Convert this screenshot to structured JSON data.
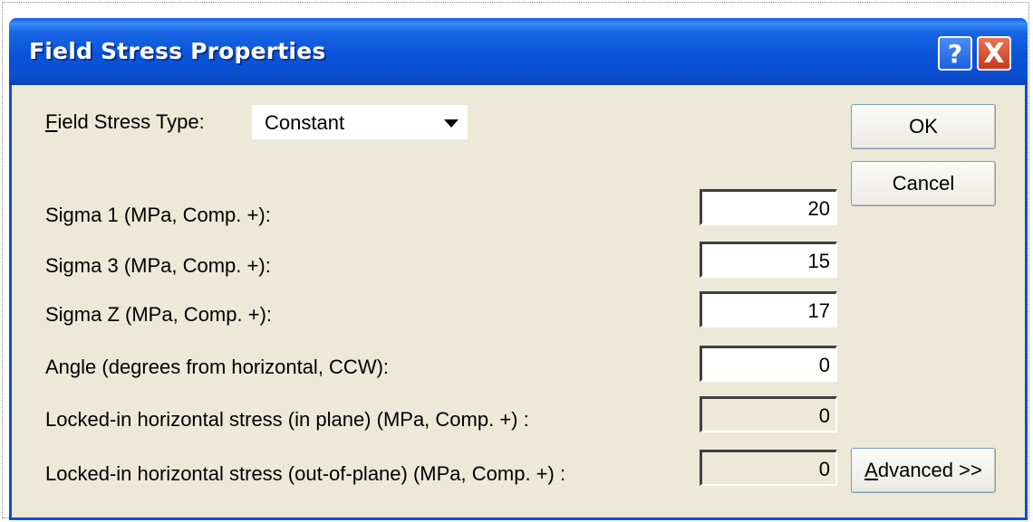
{
  "window": {
    "title": "Field Stress Properties"
  },
  "titlebar_buttons": {
    "help": "?",
    "close": "X"
  },
  "field_stress_type": {
    "label_accel": "F",
    "label_rest": "ield Stress Type:",
    "value": "Constant"
  },
  "fields": [
    {
      "label": "Sigma 1 (MPa, Comp. +):",
      "value": "20",
      "enabled": true
    },
    {
      "label": "Sigma 3 (MPa, Comp. +):",
      "value": "15",
      "enabled": true
    },
    {
      "label": "Sigma Z (MPa, Comp. +):",
      "value": "17",
      "enabled": true
    },
    {
      "label": "Angle (degrees from horizontal, CCW):",
      "value": "0",
      "enabled": true
    },
    {
      "label": "Locked-in horizontal stress (in plane) (MPa, Comp. +) :",
      "value": "0",
      "enabled": false
    },
    {
      "label": "Locked-in horizontal stress (out-of-plane) (MPa, Comp. +) :",
      "value": "0",
      "enabled": false
    }
  ],
  "buttons": {
    "ok": "OK",
    "cancel": "Cancel",
    "advanced_accel": "A",
    "advanced_rest": "dvanced >>"
  },
  "colors": {
    "titlebar": "#0a53d8",
    "dialog_bg": "#ece9d8",
    "close": "#c8391a"
  }
}
